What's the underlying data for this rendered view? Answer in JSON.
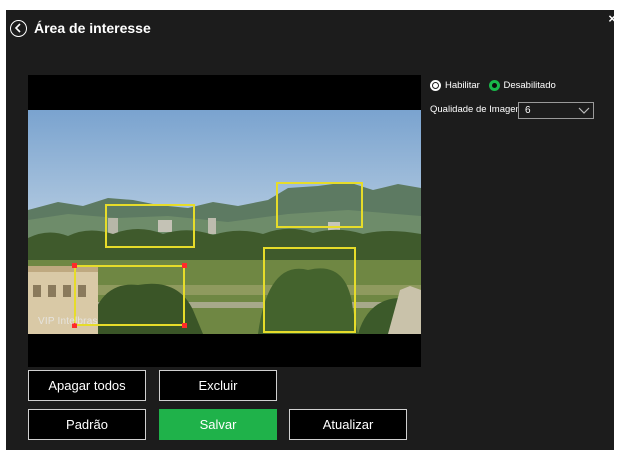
{
  "header": {
    "title": "Área de interesse",
    "close_label": "×"
  },
  "video": {
    "watermark": "VIP Intelbras"
  },
  "controls": {
    "enable_label": "Habilitar",
    "disable_label": "Desabilitado",
    "quality_label": "Qualidade de Imagem",
    "quality_value": "6"
  },
  "buttons": {
    "clear_all": "Apagar todos",
    "delete": "Excluir",
    "default": "Padrão",
    "save": "Salvar",
    "refresh": "Atualizar"
  },
  "colors": {
    "accent": "#1fb24a",
    "roi": "#e6dc2a",
    "handle": "#ff2a2a"
  }
}
